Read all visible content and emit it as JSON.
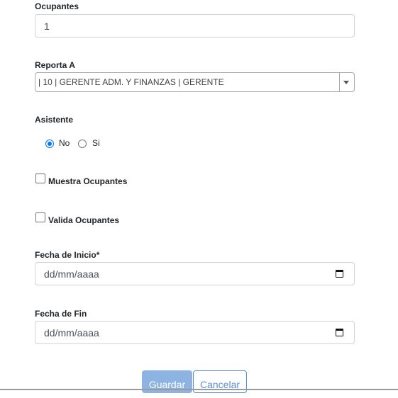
{
  "form": {
    "ocupantes": {
      "label": "Ocupantes",
      "value": "1"
    },
    "reporta": {
      "label": "Reporta A",
      "selected": "| 10 | GERENTE ADM. Y FINANZAS | GERENTE"
    },
    "asistente": {
      "label": "Asistente",
      "options": [
        "No",
        "Si"
      ],
      "selected": "No"
    },
    "muestra_ocupantes": {
      "label": "Muestra Ocupantes",
      "checked": false
    },
    "valida_ocupantes": {
      "label": "Valida Ocupantes",
      "checked": false
    },
    "fecha_inicio": {
      "label": "Fecha de Inicio*",
      "placeholder": "dd/mm/aaaa"
    },
    "fecha_fin": {
      "label": "Fecha de Fin",
      "placeholder": "dd/mm/aaaa"
    }
  },
  "actions": {
    "save_label": "Guardar",
    "cancel_label": "Cancelar"
  },
  "colors": {
    "primary_button": "#8db3e2",
    "outline_button": "#5a8fd6",
    "radio_checked": "#0075ff"
  }
}
